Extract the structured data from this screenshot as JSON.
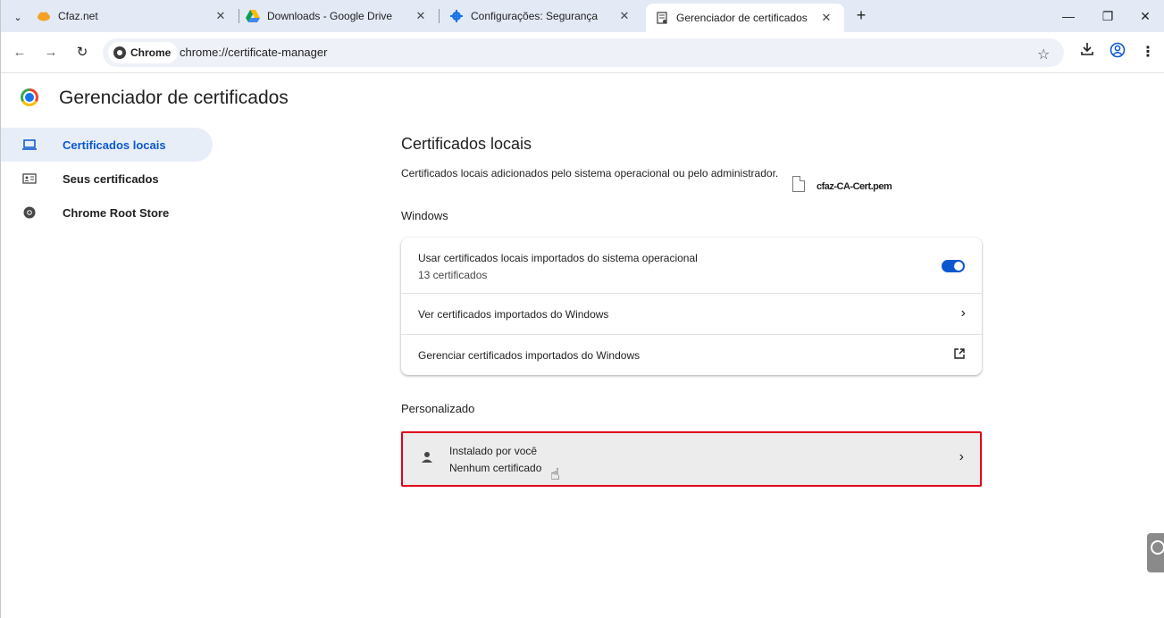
{
  "tabs": [
    {
      "title": "Cfaz.net",
      "favicon": "cloud-icon",
      "active": false
    },
    {
      "title": "Downloads - Google Drive",
      "favicon": "google-drive-icon",
      "active": false
    },
    {
      "title": "Configurações: Segurança",
      "favicon": "settings-gear-icon",
      "active": false
    },
    {
      "title": "Gerenciador de certificados",
      "favicon": "certificate-icon",
      "active": true
    }
  ],
  "toolbar": {
    "chip_label": "Chrome",
    "url": "chrome://certificate-manager"
  },
  "page": {
    "title": "Gerenciador de certificados"
  },
  "sidebar": {
    "items": [
      {
        "label": "Certificados locais",
        "icon": "laptop-icon",
        "active": true
      },
      {
        "label": "Seus certificados",
        "icon": "id-card-icon",
        "active": false
      },
      {
        "label": "Chrome Root Store",
        "icon": "chrome-icon",
        "active": false
      }
    ]
  },
  "main": {
    "section_title": "Certificados locais",
    "section_desc": "Certificados locais adicionados pelo sistema operacional ou pelo administrador.",
    "windows_heading": "Windows",
    "windows_rows": {
      "use_os": {
        "primary": "Usar certificados locais importados do sistema operacional",
        "secondary": "13 certificados",
        "toggle_on": true
      },
      "view": {
        "primary": "Ver certificados importados do Windows"
      },
      "manage": {
        "primary": "Gerenciar certificados importados do Windows"
      }
    },
    "custom_heading": "Personalizado",
    "custom_row": {
      "primary": "Instalado por você",
      "secondary": "Nenhum certificado"
    }
  },
  "dragged_file": {
    "name": "cfaz-CA-Cert.pem"
  },
  "colors": {
    "accent": "#0b57d0",
    "highlight_border": "#e0001a",
    "tabstrip_bg": "#e3e9f5"
  }
}
